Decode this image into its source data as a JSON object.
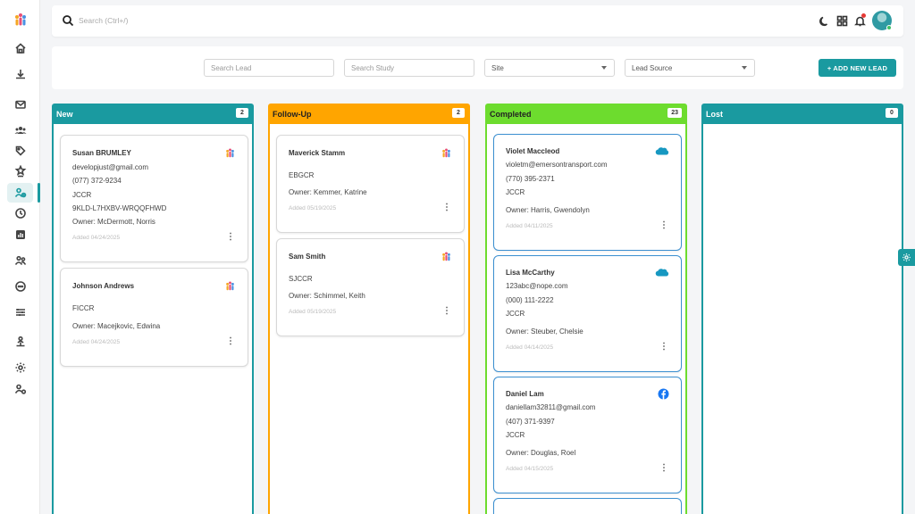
{
  "colors": {
    "accent": "#1a9aa0",
    "new": "#1a9aa0",
    "followup": "#ffa500",
    "completed": "#6ddc2e",
    "lost": "#1a9aa0",
    "card_highlight": "#3b8fd0"
  },
  "topbar": {
    "search_placeholder": "Search (Ctrl+/)",
    "icons": [
      "moon-icon",
      "grid-icon",
      "bell-icon",
      "avatar"
    ]
  },
  "filters": {
    "search_lead_placeholder": "Search Lead",
    "search_study_placeholder": "Search Study",
    "site_label": "Site",
    "lead_source_label": "Lead Source",
    "add_button_label": "+ ADD NEW LEAD"
  },
  "columns": [
    {
      "title": "New",
      "count": "2",
      "cards": [
        {
          "name": "Susan BRUMLEY",
          "lines": [
            "developjust@gmail.com",
            "(077) 372-9234",
            "JCCR",
            "9KLD-L7HXBV-WRQQFHWD",
            "Owner:  McDermott, Norris"
          ],
          "added": "Added 04/24/2025",
          "source": "logo-icon"
        },
        {
          "name": "Johnson Andrews",
          "lines": [
            "FICCR",
            "Owner:  Macejkovic, Edwina"
          ],
          "added": "Added 04/24/2025",
          "source": "logo-icon"
        }
      ]
    },
    {
      "title": "Follow-Up",
      "count": "2",
      "cards": [
        {
          "name": "Maverick Stamm",
          "lines": [
            "EBGCR",
            "Owner:  Kemmer, Katrine"
          ],
          "added": "Added 05/19/2025",
          "source": "logo-icon"
        },
        {
          "name": "Sam Smith",
          "lines": [
            "SJCCR",
            "Owner:  Schimmel, Keith"
          ],
          "added": "Added 05/19/2025",
          "source": "logo-icon"
        }
      ]
    },
    {
      "title": "Completed",
      "count": "23",
      "cards": [
        {
          "name": "Violet Maccleod",
          "lines": [
            "violetm@emersontransport.com",
            "(770) 395-2371",
            "JCCR",
            "Owner:  Harris, Gwendolyn"
          ],
          "added": "Added 04/11/2025",
          "source": "salesforce-icon"
        },
        {
          "name": "Lisa McCarthy",
          "lines": [
            "123abc@nope.com",
            "(000) 111-2222",
            "JCCR",
            "Owner:  Steuber, Chelsie"
          ],
          "added": "Added 04/14/2025",
          "source": "salesforce-icon"
        },
        {
          "name": "Daniel Lam",
          "lines": [
            "daniellam32811@gmail.com",
            "(407) 371-9397",
            "JCCR",
            "Owner:  Douglas, Roel"
          ],
          "added": "Added 04/15/2025",
          "source": "facebook-icon"
        }
      ]
    },
    {
      "title": "Lost",
      "count": "0",
      "cards": []
    }
  ]
}
